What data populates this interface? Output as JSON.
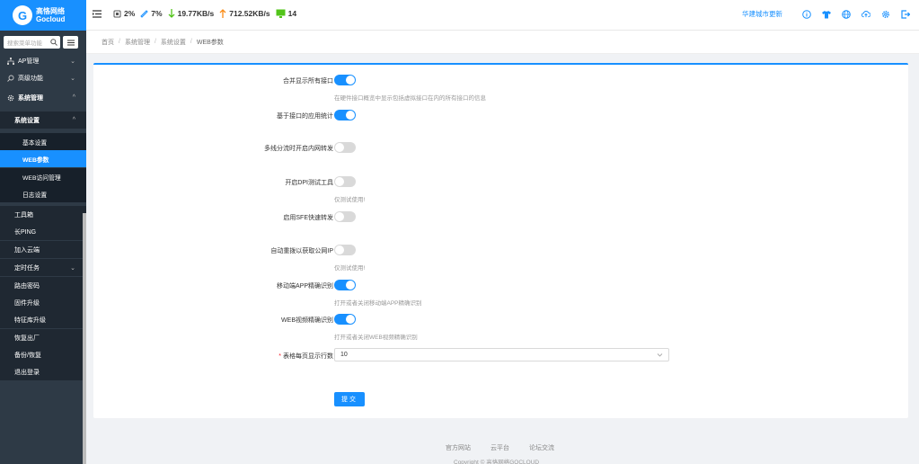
{
  "brand": {
    "name_cn": "高恪网络",
    "name_en": "Gocloud"
  },
  "stats": {
    "cpu": "2%",
    "mem": "7%",
    "download": "19.77KB/s",
    "upload": "712.52KB/s",
    "connections": "14"
  },
  "header_right": {
    "link": "华建城市更新",
    "icons": [
      "info-icon",
      "shirt-icon",
      "globe-icon",
      "cloud-upload-icon",
      "settings-icon",
      "logout-icon"
    ]
  },
  "sidebar": {
    "search_placeholder": "搜索菜单功能",
    "items": [
      {
        "label": "AP管理"
      },
      {
        "label": "高级功能"
      },
      {
        "label": "系统管理"
      },
      {
        "label": "系统设置"
      },
      {
        "label": "基本设置"
      },
      {
        "label": "WEB参数"
      },
      {
        "label": "WEB访问管理"
      },
      {
        "label": "日志设置"
      },
      {
        "label": "工具箱"
      },
      {
        "label": "长PING"
      },
      {
        "label": "加入云端"
      },
      {
        "label": "定时任务"
      },
      {
        "label": "路由密码"
      },
      {
        "label": "固件升级"
      },
      {
        "label": "特征库升级"
      },
      {
        "label": "恢复出厂"
      },
      {
        "label": "备份/恢复"
      },
      {
        "label": "退出登录"
      }
    ]
  },
  "breadcrumb": [
    "首页",
    "系统管理",
    "系统设置",
    "WEB参数"
  ],
  "form": {
    "fields": [
      {
        "label": "合并显示所有接口",
        "on": true,
        "hint": "在硬件接口概览中显示包括虚拟接口在内的所有接口的信息"
      },
      {
        "label": "基于接口的应用统计",
        "on": true,
        "hint": ""
      },
      {
        "label": "多线分流时开启内网转发",
        "on": false,
        "hint": ""
      },
      {
        "label": "开启DPI测试工具",
        "on": false,
        "hint": "仅测试使用!"
      },
      {
        "label": "启用SFE快速转发",
        "on": false,
        "hint": ""
      },
      {
        "label": "自动重拨以获取公网IP",
        "on": false,
        "hint": "仅测试使用!"
      },
      {
        "label": "移动端APP精确识别",
        "on": true,
        "hint": "打开或者关闭移动端APP精确识别"
      },
      {
        "label": "WEB视频精确识别",
        "on": true,
        "hint": "打开或者关闭WEB视频精确识别"
      }
    ],
    "rows_label": "表格每页显示行数",
    "rows_value": "10",
    "submit_label": "提交"
  },
  "footer": {
    "links": [
      "官方网站",
      "云平台",
      "论坛交流"
    ],
    "copyright": "Copyright © 高恪网络GOCLOUD"
  }
}
